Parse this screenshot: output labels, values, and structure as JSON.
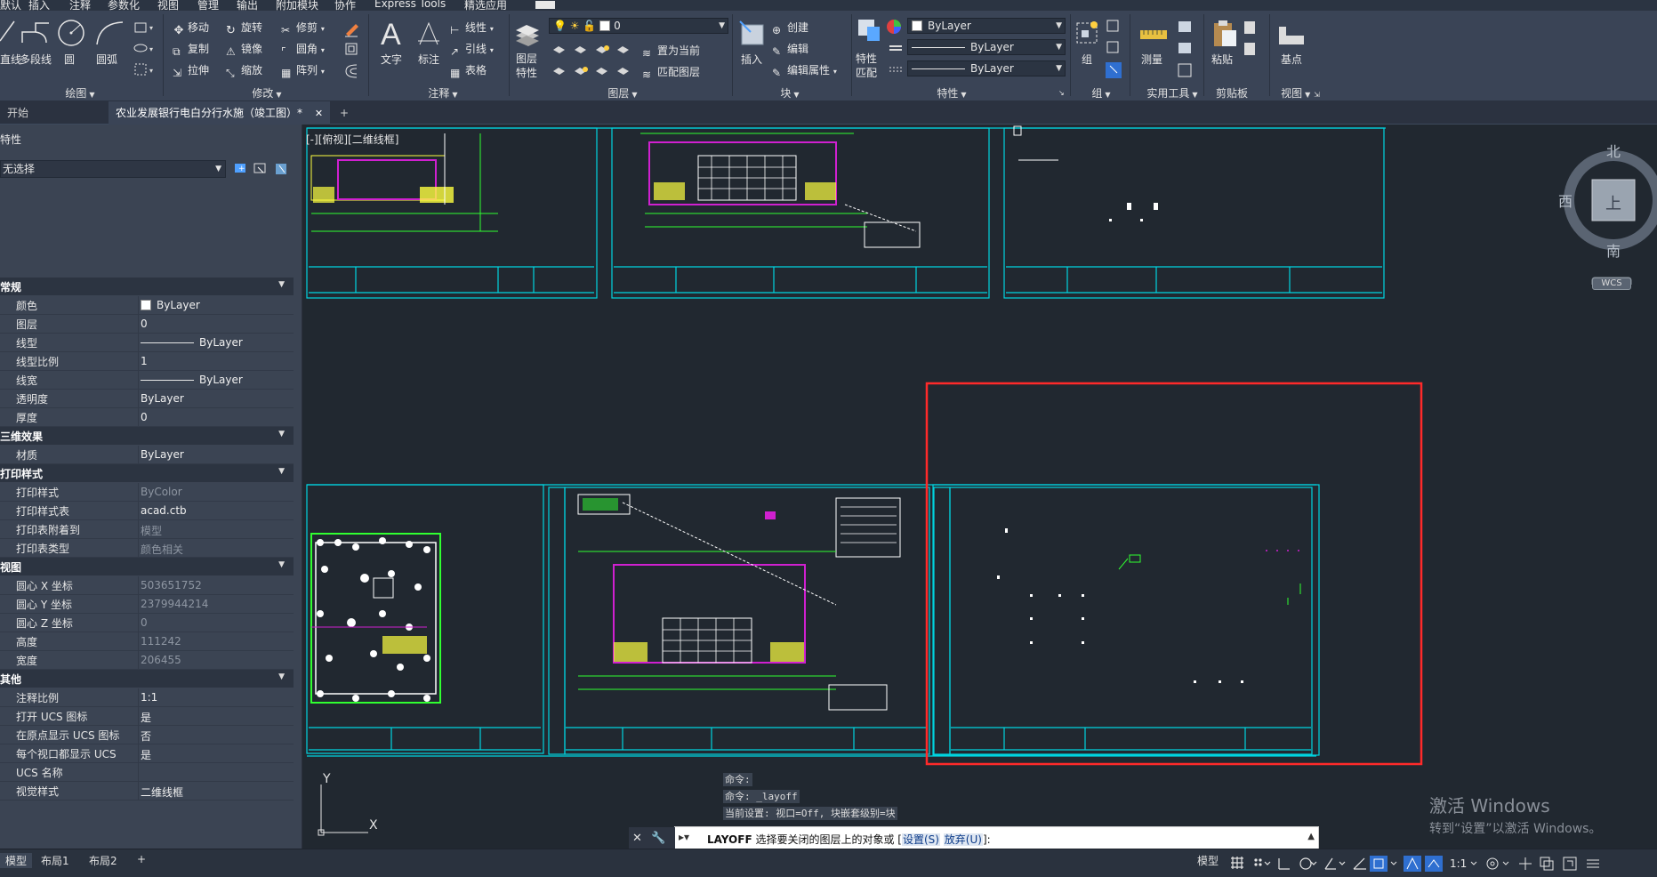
{
  "menu_tabs": [
    "默认",
    "插入",
    "注释",
    "参数化",
    "视图",
    "管理",
    "输出",
    "附加模块",
    "协作",
    "Express Tools",
    "精选应用"
  ],
  "ribbon": {
    "draw": {
      "title": "绘图",
      "line": "直线",
      "polyline": "多段线",
      "circle": "圆",
      "arc": "圆弧"
    },
    "modify": {
      "title": "修改",
      "move": "移动",
      "rotate": "旋转",
      "trim": "修剪",
      "copy": "复制",
      "mirror": "镜像",
      "fillet": "圆角",
      "stretch": "拉伸",
      "scale": "缩放",
      "array": "阵列"
    },
    "annotation": {
      "title": "注释",
      "text": "文字",
      "dimension": "标注",
      "linear": "线性",
      "leader": "引线",
      "table": "表格"
    },
    "layers": {
      "title": "图层",
      "layer_props": "图层特性",
      "current_layer": "0",
      "set_current": "置为当前",
      "match_layer": "匹配图层"
    },
    "block": {
      "title": "块",
      "insert": "插入",
      "create": "创建",
      "edit": "编辑",
      "edit_attr": "编辑属性"
    },
    "properties": {
      "title": "特性",
      "match": "特性匹配",
      "color": "ByLayer",
      "linetype": "ByLayer",
      "lineweight": "ByLayer"
    },
    "groups": {
      "title": "组",
      "group": "组"
    },
    "utilities": {
      "title": "实用工具",
      "measure": "测量"
    },
    "clipboard": {
      "title": "剪贴板",
      "paste": "粘贴"
    },
    "view": {
      "title": "视图",
      "base": "基点"
    }
  },
  "doc_tabs": {
    "start": "开始",
    "active": "农业发展银行电白分行水施（竣工图）*",
    "close": "✕",
    "add": "+"
  },
  "properties_palette": {
    "title": "特性",
    "selection": "无选择",
    "sections": [
      {
        "name": "常规",
        "rows": [
          {
            "k": "颜色",
            "v": "ByLayer"
          },
          {
            "k": "图层",
            "v": "0"
          },
          {
            "k": "线型",
            "v": "ByLayer"
          },
          {
            "k": "线型比例",
            "v": "1"
          },
          {
            "k": "线宽",
            "v": "ByLayer"
          },
          {
            "k": "透明度",
            "v": "ByLayer"
          },
          {
            "k": "厚度",
            "v": "0"
          }
        ]
      },
      {
        "name": "三维效果",
        "rows": [
          {
            "k": "材质",
            "v": "ByLayer"
          }
        ]
      },
      {
        "name": "打印样式",
        "rows": [
          {
            "k": "打印样式",
            "v": "ByColor",
            "dim": true
          },
          {
            "k": "打印样式表",
            "v": "acad.ctb"
          },
          {
            "k": "打印表附着到",
            "v": "模型",
            "dim": true
          },
          {
            "k": "打印表类型",
            "v": "颜色相关",
            "dim": true
          }
        ]
      },
      {
        "name": "视图",
        "rows": [
          {
            "k": "圆心 X 坐标",
            "v": "503651752",
            "dim": true
          },
          {
            "k": "圆心 Y 坐标",
            "v": "2379944214",
            "dim": true
          },
          {
            "k": "圆心 Z 坐标",
            "v": "0",
            "dim": true
          },
          {
            "k": "高度",
            "v": "111242",
            "dim": true
          },
          {
            "k": "宽度",
            "v": "206455",
            "dim": true
          }
        ]
      },
      {
        "name": "其他",
        "rows": [
          {
            "k": "注释比例",
            "v": "1:1"
          },
          {
            "k": "打开 UCS 图标",
            "v": "是"
          },
          {
            "k": "在原点显示 UCS 图标",
            "v": "否"
          },
          {
            "k": "每个视口都显示 UCS",
            "v": "是"
          },
          {
            "k": "UCS 名称",
            "v": ""
          },
          {
            "k": "视觉样式",
            "v": "二维线框"
          }
        ]
      }
    ]
  },
  "viewport_label": "[-][俯视][二维线框]",
  "viewcube": {
    "north": "北",
    "south": "南",
    "west": "西",
    "face": "上",
    "wcs": "WCS"
  },
  "ucs": {
    "y": "Y",
    "x": "X"
  },
  "command": {
    "history": [
      "命令:",
      "命令: _layoff",
      "当前设置: 视口=Off, 块嵌套级别=块"
    ],
    "prompt_cmd": "LAYOFF",
    "prompt_text": "选择要关闭的图层上的对象或 [",
    "opt1": "设置(S)",
    "opt2": "放弃(U)",
    "prompt_end": "]:"
  },
  "watermark": {
    "line1": "激活 Windows",
    "line2": "转到“设置”以激活 Windows。"
  },
  "status_bar": {
    "tabs": [
      "模型",
      "布局1",
      "布局2"
    ],
    "add": "+",
    "model_btn": "模型",
    "scale": "1:1"
  },
  "colors": {
    "canvas_bg": "#212830",
    "frame_cyan": "#00d4e0",
    "magenta": "#d020d0",
    "green": "#30ff30",
    "yellow": "#ffff40",
    "highlight_red": "#ff2a2a"
  }
}
